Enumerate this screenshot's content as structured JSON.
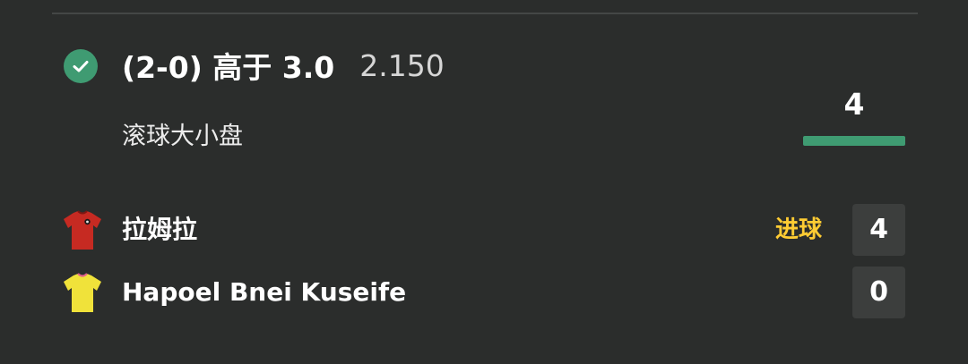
{
  "bet": {
    "status": "won",
    "selection": "(2-0) 高于 3.0",
    "odds": "2.150",
    "market": "滚球大小盘",
    "total_goals": "4",
    "progress_fraction": 1.0
  },
  "teams": [
    {
      "name": "拉姆拉",
      "score": "4",
      "tag": "进球",
      "shirt_color": "#c62a22"
    },
    {
      "name": "Hapoel Bnei Kuseife",
      "score": "0",
      "tag": "",
      "shirt_color": "#f0e23a"
    }
  ],
  "colors": {
    "background": "#2b2d2c",
    "accent_green": "#3f9b72",
    "goal_yellow": "#ffcc33"
  },
  "icons": {
    "status": "check-circle-icon",
    "home_kit": "red-shirt-icon",
    "away_kit": "yellow-shirt-icon"
  }
}
